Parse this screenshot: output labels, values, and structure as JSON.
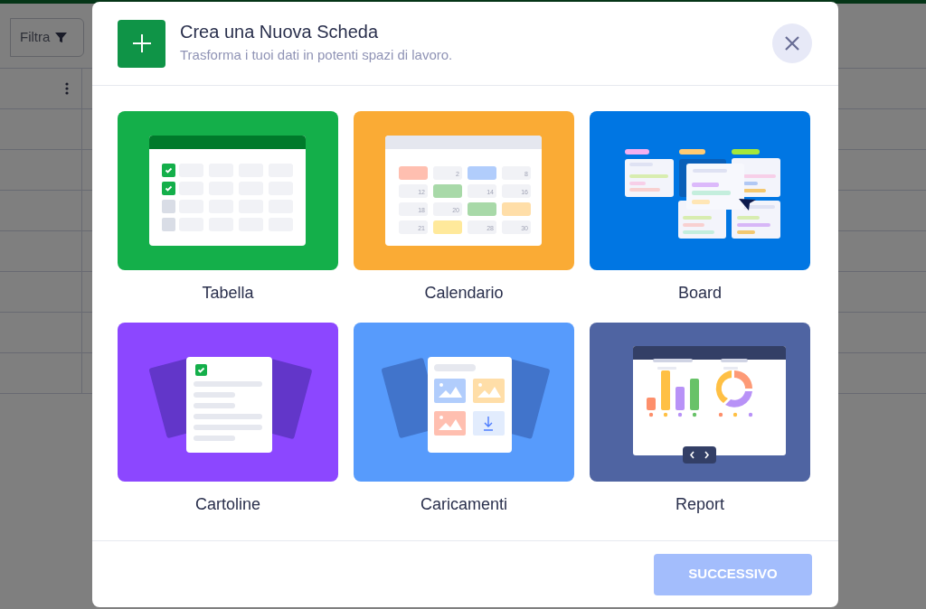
{
  "background": {
    "filter_button": {
      "label": "Filtra"
    }
  },
  "modal": {
    "title": "Crea una Nuova Scheda",
    "subtitle": "Trasforma i tuoi dati in potenti spazi di lavoro.",
    "options": [
      {
        "kind": "table",
        "label": "Tabella",
        "color": "#14af4a",
        "selected": false
      },
      {
        "kind": "calendar",
        "label": "Calendario",
        "color": "#faab35",
        "selected": false,
        "cells": [
          {
            "color": "#ffbfb0"
          },
          {
            "text": "2"
          },
          {
            "color": "#b1cdfc"
          },
          {
            "text": "8"
          },
          {
            "text": "12"
          },
          {
            "color": "#a8d9a8"
          },
          {
            "text": "14"
          },
          {
            "text": "16"
          },
          {
            "text": "18"
          },
          {
            "text": "20"
          },
          {
            "color": "#a8d9a8"
          },
          {
            "color": "#ffdea8"
          },
          {
            "text": "21"
          },
          {
            "color": "#ffe99b"
          },
          {
            "text": "28"
          },
          {
            "text": "30"
          }
        ]
      },
      {
        "kind": "board",
        "label": "Board",
        "color": "#0076e3",
        "selected": false
      },
      {
        "kind": "cards",
        "label": "Cartoline",
        "color": "#8c47ff",
        "selected": false
      },
      {
        "kind": "uploads",
        "label": "Caricamenti",
        "color": "#579bfc",
        "selected": false
      },
      {
        "kind": "report",
        "label": "Report",
        "color": "#4f64a2",
        "selected": false
      }
    ],
    "next_button": {
      "label": "SUCCESSIVO",
      "disabled": true
    }
  }
}
